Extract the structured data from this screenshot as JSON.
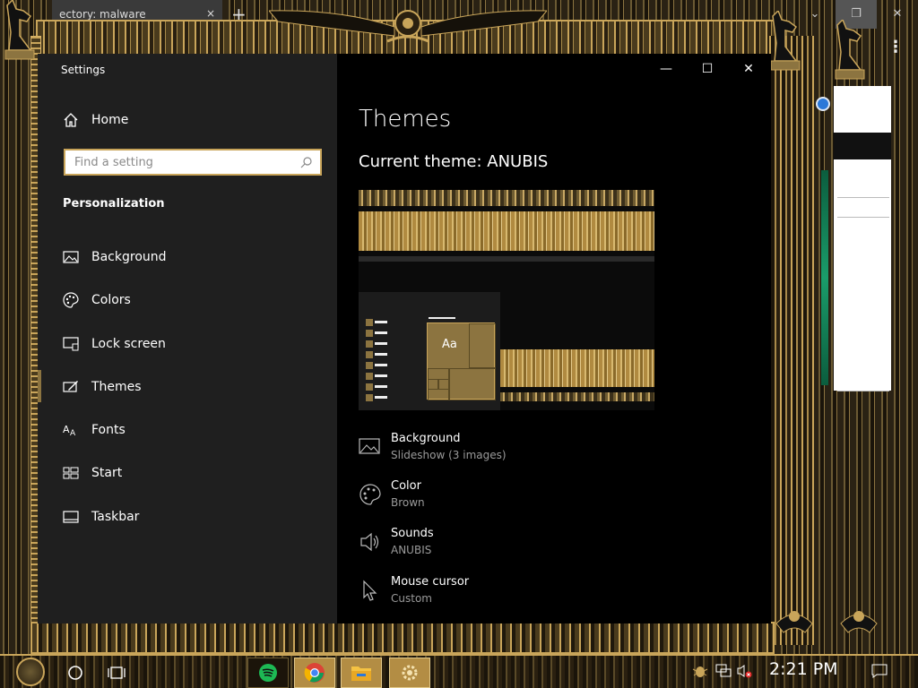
{
  "browser": {
    "tab_title": "ectory: malware",
    "tab_close": "×",
    "new_tab": "+",
    "kebab": "⋮",
    "controls": {
      "dropdown": "⌄",
      "restore": "❐",
      "close": "✕"
    }
  },
  "settings": {
    "window_title": "Settings",
    "controls": {
      "minimize": "—",
      "maximize": "☐",
      "close": "✕"
    },
    "home_label": "Home",
    "search_placeholder": "Find a setting",
    "section_title": "Personalization",
    "nav": [
      {
        "label": "Background",
        "icon": "picture-icon"
      },
      {
        "label": "Colors",
        "icon": "palette-icon"
      },
      {
        "label": "Lock screen",
        "icon": "lock-screen-icon"
      },
      {
        "label": "Themes",
        "icon": "themes-icon",
        "selected": true
      },
      {
        "label": "Fonts",
        "icon": "fonts-icon"
      },
      {
        "label": "Start",
        "icon": "start-icon"
      },
      {
        "label": "Taskbar",
        "icon": "taskbar-icon"
      }
    ],
    "content": {
      "title": "Themes",
      "current_theme": "Current theme: ANUBIS",
      "preview_sample": "Aa",
      "properties": [
        {
          "title": "Background",
          "value": "Slideshow (3 images)",
          "icon": "picture-icon"
        },
        {
          "title": "Color",
          "value": "Brown",
          "icon": "palette-icon"
        },
        {
          "title": "Sounds",
          "value": "ANUBIS",
          "icon": "speaker-icon"
        },
        {
          "title": "Mouse cursor",
          "value": "Custom",
          "icon": "cursor-icon"
        }
      ]
    }
  },
  "taskbar": {
    "time": "2:21 PM",
    "apps": [
      "spotify-icon",
      "chrome-icon",
      "file-explorer-icon",
      "settings-gear-icon"
    ]
  },
  "colors": {
    "gold": "#c9a55a",
    "accent_brown": "#8c7440",
    "sidebar_bg": "#1f1f1f",
    "content_bg": "#000000"
  }
}
